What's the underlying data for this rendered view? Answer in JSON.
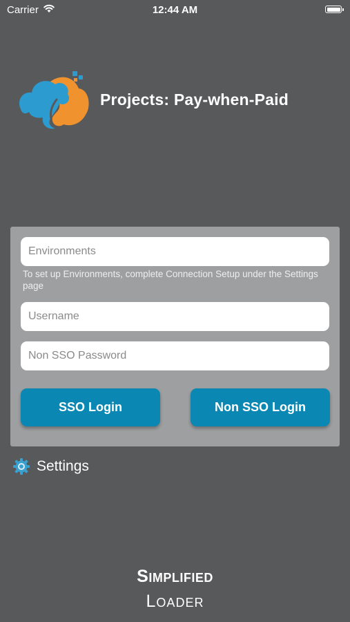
{
  "status_bar": {
    "carrier": "Carrier",
    "time": "12:44 AM"
  },
  "header": {
    "title": "Projects: Pay-when-Paid"
  },
  "login": {
    "environments_placeholder": "Environments",
    "environments_hint": "To set up Environments, complete Connection Setup under the Settings page",
    "username_placeholder": "Username",
    "password_placeholder": "Non SSO Password",
    "sso_button": "SSO Login",
    "non_sso_button": "Non SSO Login"
  },
  "settings": {
    "label": "Settings"
  },
  "footer": {
    "line1": "Simplified",
    "line2": "Loader"
  },
  "colors": {
    "background": "#58595b",
    "card": "#9e9fa1",
    "button": "#0a87b2",
    "logo_blue": "#2b9bd0",
    "logo_orange": "#f0932e"
  },
  "icons": {
    "signal": "wifi-icon",
    "battery": "battery-icon",
    "settings": "gear-icon",
    "logo": "cloud-logo-icon"
  }
}
